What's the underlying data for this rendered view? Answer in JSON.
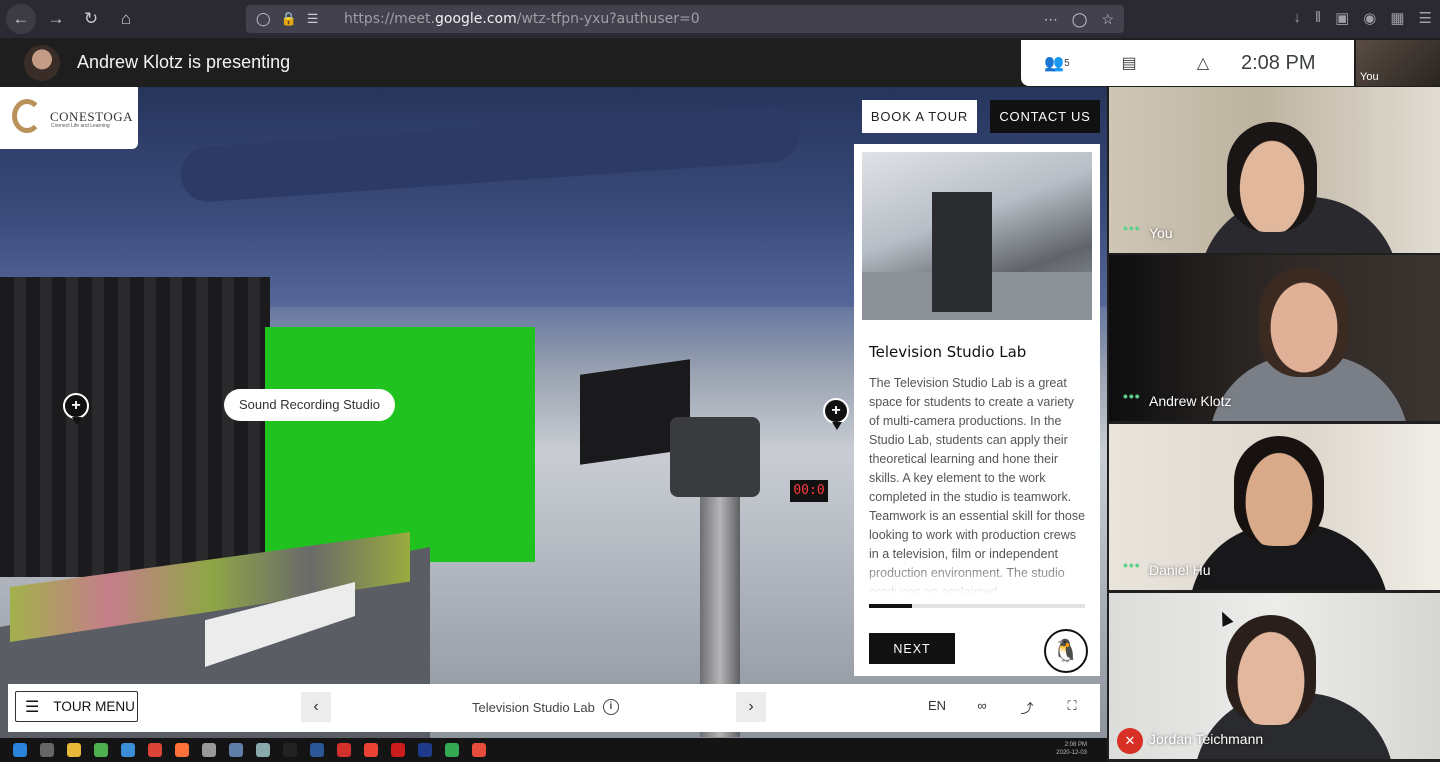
{
  "browser": {
    "url_prefix": "https://meet.",
    "url_domain": "google.com",
    "url_suffix": "/wtz-tfpn-yxu?authuser=0"
  },
  "meet": {
    "presenting_text": "Andrew Klotz is presenting",
    "participant_count": "5",
    "clock": "2:08 PM",
    "self_label": "You"
  },
  "tour": {
    "logo_name": "CONESTOGA",
    "logo_tagline": "Connect Life and Learning",
    "book_label": "BOOK A TOUR",
    "contact_label": "CONTACT US",
    "hotspot_tooltip": "Sound Recording Studio",
    "timer_display": "00:0",
    "panel": {
      "title": "Television Studio Lab",
      "body": "The Television Studio Lab is a great space for students to create a variety of multi-camera productions. In the Studio Lab, students can apply their theoretical learning and hone their skills. A key element to the work completed in the studio is teamwork. Teamwork is an essential skill for those looking to work with production crews in a television, film or independent production environment. The studio produces an acclaimed",
      "progress": 0.2,
      "next_label": "NEXT"
    },
    "bottom_bar": {
      "menu_label": "TOUR MENU",
      "scene_title": "Television Studio Lab",
      "lang": "EN"
    }
  },
  "participants": [
    {
      "name": "You",
      "muted": false
    },
    {
      "name": "Andrew Klotz",
      "muted": false
    },
    {
      "name": "Daniel Hu",
      "muted": false
    },
    {
      "name": "Jordan Teichmann",
      "muted": true
    }
  ],
  "taskbar": {
    "time": "2:08 PM",
    "date": "2020-12-03"
  },
  "colors": {
    "accent_green": "#5fd08a",
    "mute_red": "#d93025",
    "brand_gold": "#b8925a",
    "chroma_green": "#1fc21f"
  }
}
